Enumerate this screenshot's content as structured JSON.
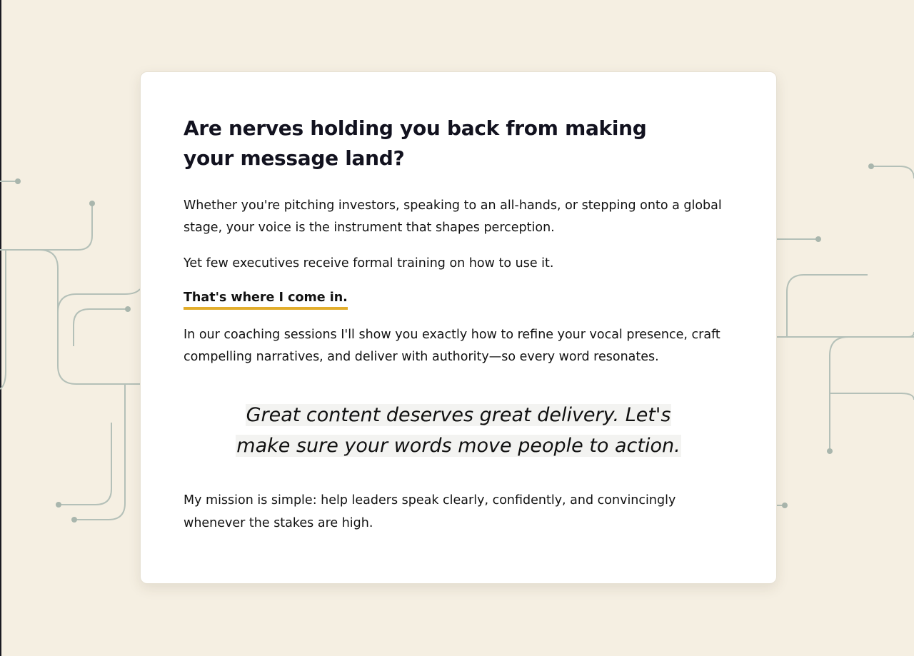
{
  "section": {
    "heading": "Are nerves holding you back from making your message land?",
    "paragraph_1": "Whether you're pitching investors, speaking to an all-hands, or stepping onto a global stage, your voice is the instrument that shapes perception.",
    "paragraph_2": "Yet few executives receive formal training on how to use it.",
    "highlight": "That's where I come in.",
    "paragraph_3": "In our coaching sessions I'll show you exactly how to refine your vocal presence, craft compelling narratives, and deliver with authority—so every word resonates.",
    "quote": "Great content deserves great delivery. Let's make sure your words move people to action.",
    "paragraph_4": "My mission is simple: help leaders speak clearly, confidently, and convincingly whenever the stakes are high."
  },
  "colors": {
    "background": "#f5efe2",
    "card": "#ffffff",
    "heading": "#12121f",
    "highlight_underline": "#e2ad2c",
    "circuit_lines": "#b4c0b8"
  }
}
